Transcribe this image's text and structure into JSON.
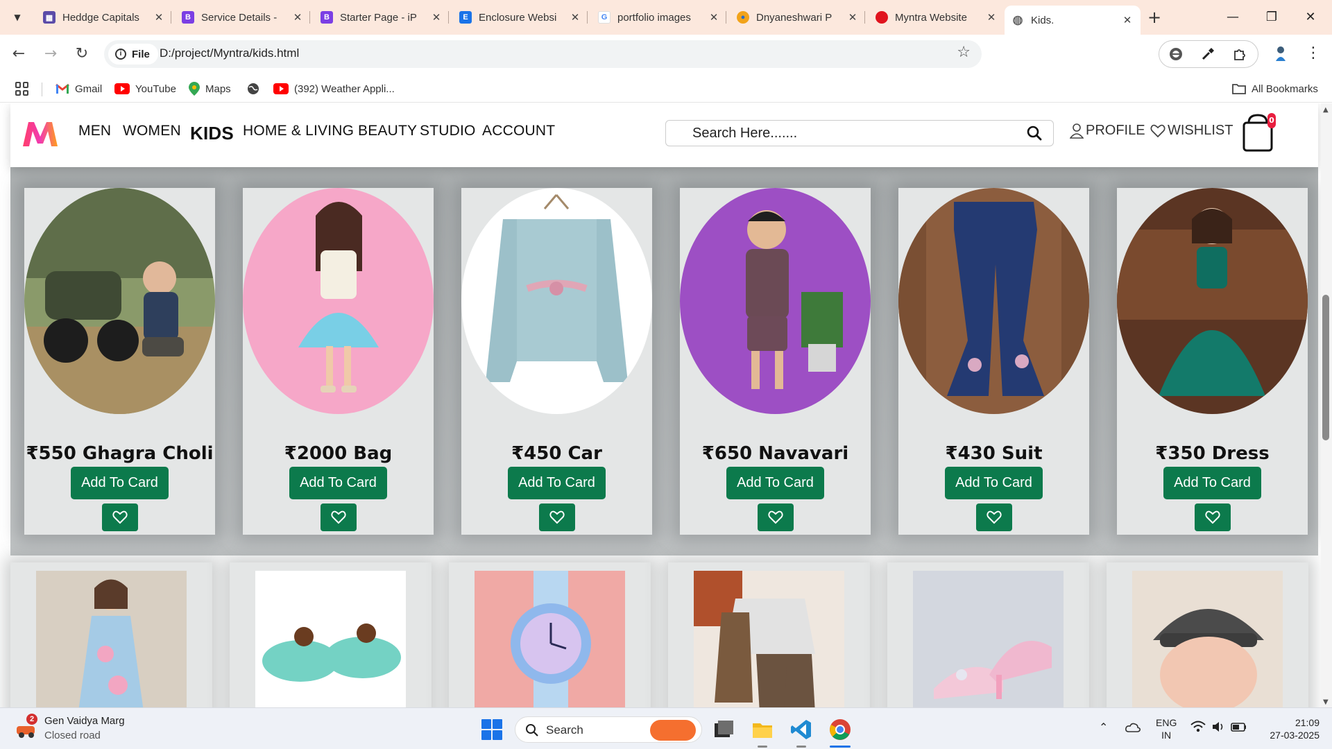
{
  "browser": {
    "tabs": [
      {
        "title": "Heddge Capitals",
        "favicon_color": "#5b4ba8",
        "favicon_glyph": "▦",
        "active": false
      },
      {
        "title": "Service Details -",
        "favicon_color": "#7b3fe4",
        "favicon_glyph": "B",
        "active": false
      },
      {
        "title": "Starter Page - iP",
        "favicon_color": "#7b3fe4",
        "favicon_glyph": "B",
        "active": false
      },
      {
        "title": "Enclosure Websi",
        "favicon_color": "#1a73e8",
        "favicon_glyph": "E",
        "active": false
      },
      {
        "title": "portfolio images",
        "favicon_color": "#ffffff",
        "favicon_glyph": "G",
        "active": false
      },
      {
        "title": "Dnyaneshwari P",
        "favicon_color": "#f2a31a",
        "favicon_glyph": "●",
        "active": false
      },
      {
        "title": "Myntra Website",
        "favicon_color": "#e0141e",
        "favicon_glyph": "●",
        "active": false
      },
      {
        "title": "Kids.",
        "favicon_color": "#8c8c8c",
        "favicon_glyph": "◍",
        "active": true
      }
    ],
    "address": {
      "chip_label": "File",
      "url": "D:/project/Myntra/kids.html"
    },
    "bookmarks": [
      {
        "label": "Gmail",
        "icon": "gmail-icon"
      },
      {
        "label": "YouTube",
        "icon": "youtube-icon"
      },
      {
        "label": "Maps",
        "icon": "maps-icon"
      },
      {
        "label": "",
        "icon": "globe-icon"
      },
      {
        "label": "(392) Weather Appli...",
        "icon": "youtube-icon"
      }
    ],
    "all_bookmarks": "All Bookmarks"
  },
  "site": {
    "menu": [
      "MEN",
      "WOMEN",
      "KIDS",
      "HOME & LIVING",
      "BEAUTY",
      "STUDIO",
      "ACCOUNT"
    ],
    "search_placeholder": "Search Here.......",
    "profile": "PROFILE",
    "wishlist": "WISHLIST",
    "cart_count": "0",
    "accent": "#0c7a4c",
    "products": [
      {
        "price_name": "₹550 Ghagra Choli",
        "button": "Add To Card",
        "image": "boy-with-toy-motorbike"
      },
      {
        "price_name": "₹2000 Bag",
        "button": "Add To Card",
        "image": "girl-in-blue-tutu-dress"
      },
      {
        "price_name": "₹450 Car",
        "button": "Add To Card",
        "image": "light-blue-sweater-with-bow"
      },
      {
        "price_name": "₹650 Navavari",
        "button": "Add To Card",
        "image": "boy-in-denim-shirt-shorts"
      },
      {
        "price_name": "₹430 Suit",
        "button": "Add To Card",
        "image": "flared-denim-pants"
      },
      {
        "price_name": "₹350 Dress",
        "button": "Add To Card",
        "image": "girl-in-green-gown"
      }
    ],
    "products_row2": [
      {
        "image": "girl-in-blue-floral-dress"
      },
      {
        "image": "mint-slide-sandals"
      },
      {
        "image": "light-up-kids-watch"
      },
      {
        "image": "boys-party-suit-set"
      },
      {
        "image": "pink-glitter-heels"
      },
      {
        "image": "baby-in-flat-cap"
      }
    ]
  },
  "taskbar": {
    "weather_badge": "2",
    "weather_title": "Gen Vaidya Marg",
    "weather_sub": "Closed road",
    "search_label": "Search",
    "lang_1": "ENG",
    "lang_2": "IN",
    "time": "21:09",
    "date": "27-03-2025"
  }
}
